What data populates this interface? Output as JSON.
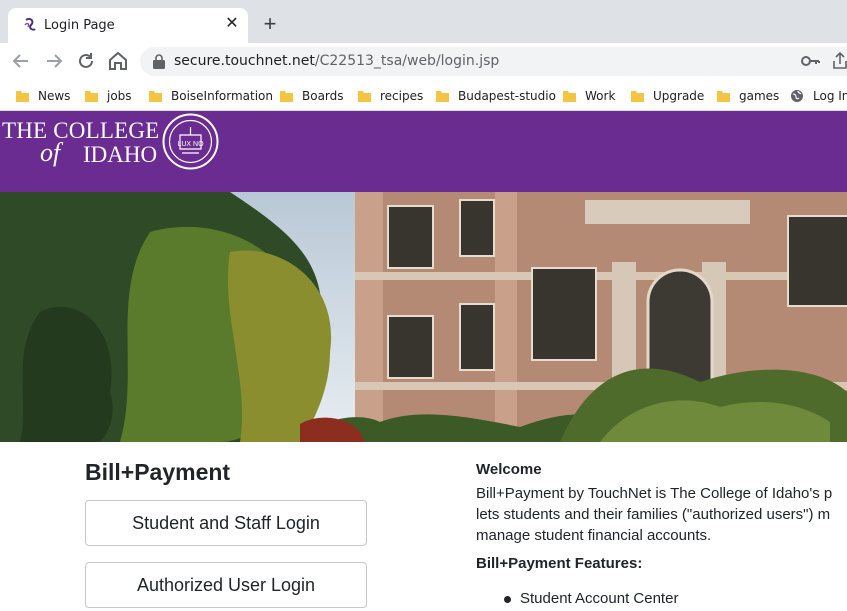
{
  "browser": {
    "tab": {
      "title": "Login Page"
    },
    "address": {
      "host": "secure.touchnet.net",
      "path": "/C22513_tsa/web/login.jsp"
    },
    "bookmarks": [
      {
        "label": "News",
        "icon": "folder-icon"
      },
      {
        "label": "jobs",
        "icon": "folder-icon"
      },
      {
        "label": "BoiseInformation",
        "icon": "folder-icon"
      },
      {
        "label": "Boards",
        "icon": "folder-icon"
      },
      {
        "label": "recipes",
        "icon": "folder-icon"
      },
      {
        "label": "Budapest-studio",
        "icon": "folder-icon"
      },
      {
        "label": "Work",
        "icon": "folder-icon"
      },
      {
        "label": "Upgrade",
        "icon": "folder-icon"
      },
      {
        "label": "games",
        "icon": "folder-icon"
      },
      {
        "label": "Log In",
        "icon": "globe-icon"
      }
    ]
  },
  "banner": {
    "logo_line1": "THE COLLEGE",
    "logo_of": "of",
    "logo_line2": "IDAHO",
    "seal_text": "LUX NO",
    "color": "#6b2c91"
  },
  "login": {
    "title": "Bill+Payment",
    "student_button": "Student and Staff Login",
    "authorized_button": "Authorized User Login"
  },
  "welcome": {
    "heading": "Welcome",
    "line1": "Bill+Payment by TouchNet is The College of Idaho's p",
    "line2": "lets students and their families (\"authorized users\") m",
    "line3": "manage student financial accounts.",
    "features_heading": "Bill+Payment Features:",
    "features": [
      "Student Account Center"
    ]
  }
}
